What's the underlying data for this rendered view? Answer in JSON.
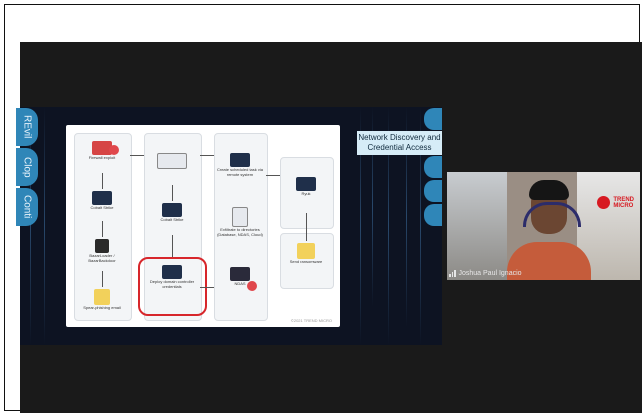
{
  "left_tabs": [
    {
      "label": "REvil"
    },
    {
      "label": "Clop"
    },
    {
      "label": "Conti"
    }
  ],
  "callout": {
    "text": "Network Discovery and Credential Access"
  },
  "slide": {
    "nodes": [
      {
        "label": "Firewall exploit"
      },
      {
        "label": "Cobalt Strike"
      },
      {
        "label": "BazarLoader / BazarBackdoor"
      },
      {
        "label": "Spear-phishing email"
      },
      {
        "label": "Cobalt Strike"
      },
      {
        "label": "Deploy domain controller credentials"
      },
      {
        "label": "Create scheduled task via remote system"
      },
      {
        "label": "Exfiltrate to directories (Database, NDAS, Cloud)"
      },
      {
        "label": "NDAS"
      },
      {
        "label": "Ryuk"
      },
      {
        "label": "Send ransomware"
      }
    ],
    "footer": "©2021 TREND MICRO"
  },
  "camera": {
    "name": "Joshua Paul Ignacio",
    "logo_line1": "TREND",
    "logo_line2": "MICRO"
  },
  "colors": {
    "accent": "#2f86b8",
    "highlight": "#d7262b",
    "brand": "#d71921"
  }
}
